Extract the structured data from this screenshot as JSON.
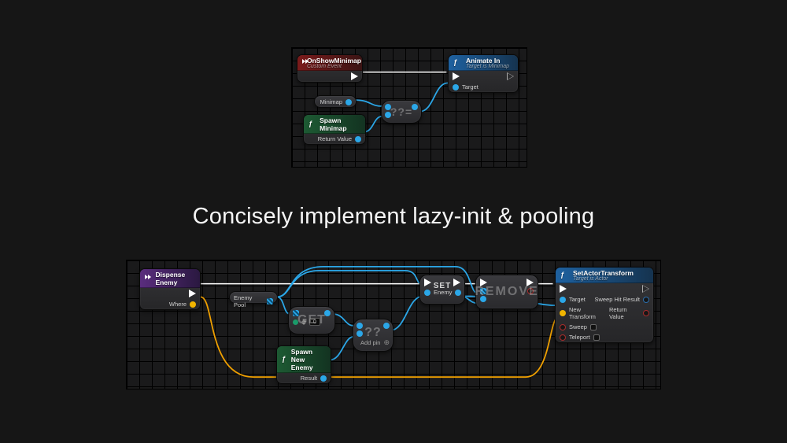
{
  "headline": "Concisely implement lazy-init & pooling",
  "top": {
    "event": {
      "title": "OnShowMinimap",
      "subtitle": "Custom Event"
    },
    "minimap_var": "Minimap",
    "spawn": {
      "title": "Spawn Minimap",
      "return": "Return Value"
    },
    "coalesce_op": "??=",
    "animate": {
      "title": "Animate In",
      "subtitle": "Target is Minimap",
      "target_label": "Target"
    }
  },
  "bot": {
    "dispense": {
      "title": "Dispense Enemy",
      "where": "Where"
    },
    "pool_var": "Enemy Pool",
    "get": {
      "big": "GET",
      "index": "0"
    },
    "spawn_enemy": {
      "title": "Spawn New Enemy",
      "result": "Result"
    },
    "coalesce": {
      "op": "??",
      "addpin": "Add pin"
    },
    "set": {
      "big": "SET",
      "label": "Enemy"
    },
    "remove_big": "REMOVE",
    "transform": {
      "title": "SetActorTransform",
      "subtitle": "Target is Actor",
      "target": "Target",
      "new_transform": "New Transform",
      "sweep": "Sweep",
      "teleport": "Teleport",
      "sweep_hit": "Sweep Hit Result",
      "return": "Return Value"
    }
  }
}
